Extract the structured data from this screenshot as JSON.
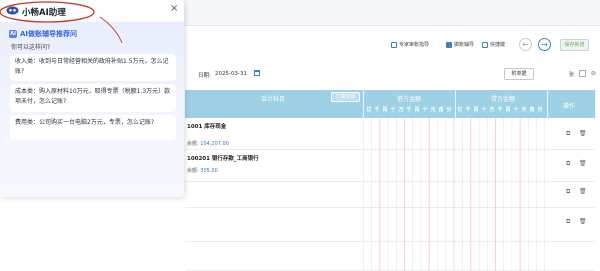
{
  "ai_panel": {
    "title": "小畅AI助理",
    "close_icon": "×",
    "recommend_label": "AI做账辅导推荐问",
    "recommend_icon_text": "AI",
    "ask_prompt": "你可以这样问?",
    "questions": [
      "收入类：收到与日常经营相关的政府补贴1.5万元，怎么记账?",
      "成本类：购入原材料10万元，取得专票（税额1.3万元）款项未付，怎么记账?",
      "费用类：公司购买一台电脑2万元，专票，怎么记账?"
    ]
  },
  "toolbar": {
    "expert_guide": "专家审账指导",
    "ledger_aid": "做账辅导",
    "shortcut": "快捷键",
    "prev_icon": "←",
    "next_icon": "→",
    "save_add": "保存新增"
  },
  "voucher": {
    "date_label": "日期:",
    "date_value": "2025-03-31",
    "attach_button": "附单据",
    "zhang_label": "张"
  },
  "table": {
    "col_subject": "会计科目",
    "copy_button": "订阅记账",
    "col_debit": "借方金额",
    "col_credit": "贷方金额",
    "col_action": "操作",
    "debit_digits": [
      "亿",
      "千",
      "百",
      "十",
      "万",
      "千",
      "百",
      "十",
      "元",
      "角",
      "分"
    ],
    "credit_digits": [
      "亿",
      "千",
      "百",
      "十",
      "万",
      "千",
      "百",
      "十",
      "元",
      "角",
      "分"
    ],
    "rows": [
      {
        "subject": "1001 库存现金",
        "balance_label": "余额:",
        "balance": "104,207.00"
      },
      {
        "subject": "100201 银行存款_工商银行",
        "balance_label": "余额:",
        "balance": "305.00"
      }
    ]
  },
  "colors": {
    "header_bg": "#9ed0e6",
    "accent_blue": "#3b82c4",
    "annotation_red": "#c0392b",
    "recommend_blue": "#3a63e0"
  }
}
